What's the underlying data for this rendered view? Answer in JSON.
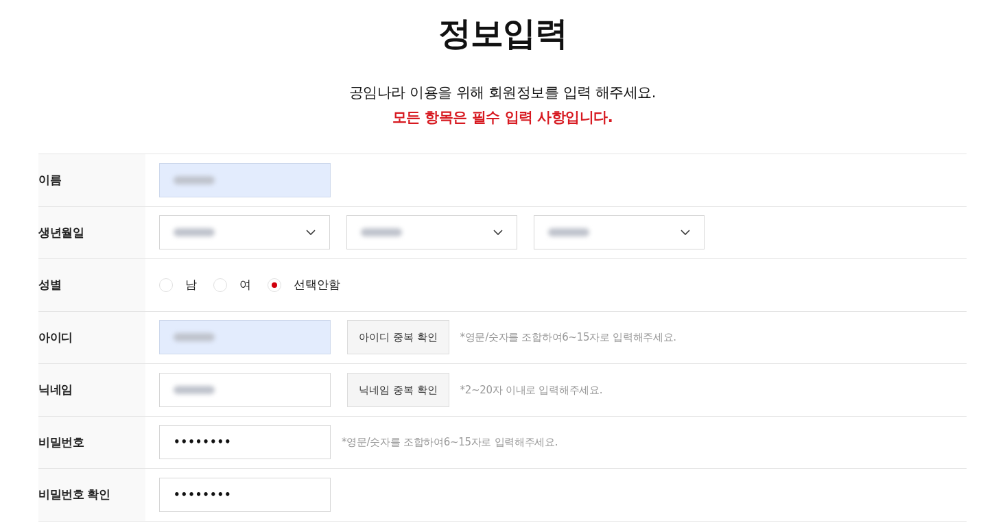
{
  "title": "정보입력",
  "intro": "공임나라 이용을 위해 회원정보를 입력 해주세요.",
  "notice": "모든 항목은 필수 입력 사항입니다.",
  "rows": [
    {
      "label": "이름",
      "kind": "text",
      "value_blurred": true,
      "autofilled": true
    },
    {
      "label": "생년월일",
      "kind": "select",
      "selects": [
        {
          "value_blurred": true
        },
        {
          "value_blurred": true
        },
        {
          "value_blurred": true
        }
      ]
    },
    {
      "label": "성별",
      "kind": "radio",
      "options": [
        {
          "label": "남",
          "selected": false
        },
        {
          "label": "여",
          "selected": false
        },
        {
          "label": "선택안함",
          "selected": true
        }
      ]
    },
    {
      "label": "아이디",
      "kind": "text",
      "value_blurred": true,
      "autofilled": true,
      "button": "아이디 중복 확인",
      "hint": "*영문/숫자를 조합하여6~15자로 입력해주세요."
    },
    {
      "label": "닉네임",
      "kind": "text",
      "value_blurred": true,
      "autofilled": false,
      "button": "닉네임 중복 확인",
      "hint": "*2~20자 이내로 입력해주세요."
    },
    {
      "label": "비밀번호",
      "kind": "password",
      "value": "••••••••",
      "hint": "*영문/숫자를 조합하여6~15자로 입력해주세요."
    },
    {
      "label": "비밀번호 확인",
      "kind": "password",
      "value": "••••••••"
    }
  ]
}
